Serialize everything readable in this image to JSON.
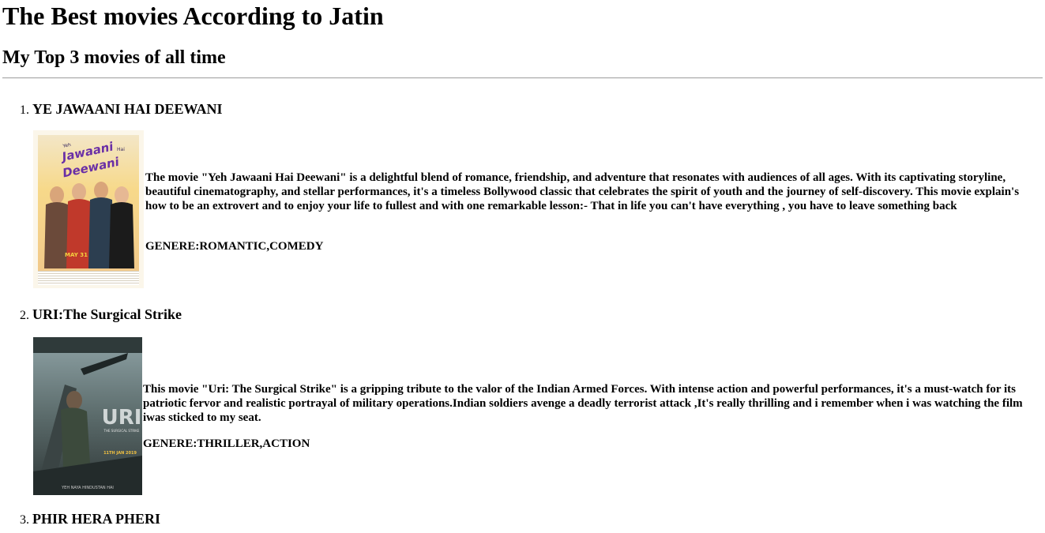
{
  "page": {
    "title": "The Best movies According to Jatin",
    "subtitle": "My Top 3 movies of all time"
  },
  "movies": [
    {
      "number": "1.",
      "title": "YE JAWAANI HAI DEEWANI",
      "description": "The movie \"Yeh Jawaani Hai Deewani\" is a delightful blend of romance, friendship, and adventure that resonates with audiences of all ages. With its captivating storyline, beautiful cinematography, and stellar performances, it's a timeless Bollywood classic that celebrates the spirit of youth and the journey of self-discovery. This movie explain's how to be an extrovert and to enjoy your life to fullest and with one remarkable lesson:- That in life you can't have everything , you have to leave something back",
      "genre": "GENERE:ROMANTIC,COMEDY",
      "poster_text": "Yeh Jawaani Hai Deewani"
    },
    {
      "number": "2.",
      "title": "URI:The Surgical Strike",
      "description": "This movie \"Uri: The Surgical Strike\" is a gripping tribute to the valor of the Indian Armed Forces. With intense action and powerful performances, it's a must-watch for its patriotic fervor and realistic portrayal of military operations.Indian soldiers avenge a deadly terrorist attack ,It's really thrilling and i remember when i was watching the film iwas sticked to my seat.",
      "genre": "GENERE:THRILLER,ACTION",
      "poster_text": "URI"
    },
    {
      "number": "3.",
      "title": "PHIR HERA PHERI"
    }
  ],
  "colors": {
    "text": "#000000",
    "background": "#ffffff",
    "divider": "#a9a9a9"
  }
}
